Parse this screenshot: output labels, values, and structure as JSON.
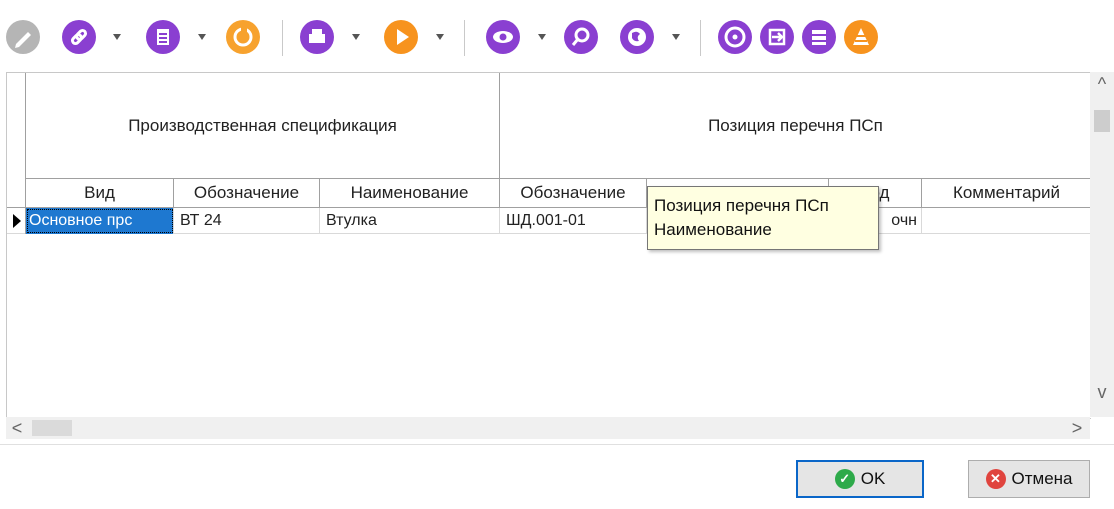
{
  "toolbar": {
    "icons": [
      {
        "name": "pencil-icon",
        "color": "#b5b5b5",
        "glyph": "✎"
      },
      {
        "name": "link-icon",
        "color": "#8a3fd1",
        "glyph": "🔗"
      },
      {
        "name": "clipboard-icon",
        "color": "#8a3fd1",
        "glyph": "▤"
      },
      {
        "name": "refresh-icon",
        "color": "#f7a22e",
        "glyph": "⟳"
      },
      {
        "name": "printer-icon",
        "color": "#8a3fd1",
        "glyph": "⎙"
      },
      {
        "name": "play-icon",
        "color": "#f7931e",
        "glyph": "▶"
      },
      {
        "name": "eye-icon",
        "color": "#8a3fd1",
        "glyph": "◉"
      },
      {
        "name": "search-icon",
        "color": "#8a3fd1",
        "glyph": "⌕"
      },
      {
        "name": "globe-icon",
        "color": "#8a3fd1",
        "glyph": "◍"
      },
      {
        "name": "disc-icon",
        "color": "#8a3fd1",
        "glyph": "◎"
      },
      {
        "name": "export-icon",
        "color": "#8a3fd1",
        "glyph": "⇥"
      },
      {
        "name": "database-icon",
        "color": "#8a3fd1",
        "glyph": "≣"
      },
      {
        "name": "cone-icon",
        "color": "#f7931e",
        "glyph": "▲"
      }
    ]
  },
  "grid": {
    "group_headers": [
      "Производственная спецификация",
      "Позиция перечня ПСп"
    ],
    "columns": [
      "Вид",
      "Обозначение",
      "Наименование",
      "Обозначение",
      "Наименование",
      "Код",
      "Комментарий"
    ],
    "rows": [
      {
        "cells": [
          "Основное прс",
          "ВТ 24",
          "Втулка",
          "ШД.001-01",
          "",
          "очн",
          ""
        ]
      }
    ]
  },
  "tooltip": {
    "line1": "Позиция перечня ПСп",
    "line2": "Наименование"
  },
  "scroll": {
    "up": "^",
    "down": "v",
    "left": "<",
    "right": ">"
  },
  "buttons": {
    "ok": "OK",
    "cancel": "Отмена"
  },
  "colors": {
    "accent": "#8a3fd1",
    "orange": "#f7931e",
    "selection": "#1e78d0",
    "ok_green": "#2eaa4a",
    "cancel_red": "#e0443e"
  }
}
